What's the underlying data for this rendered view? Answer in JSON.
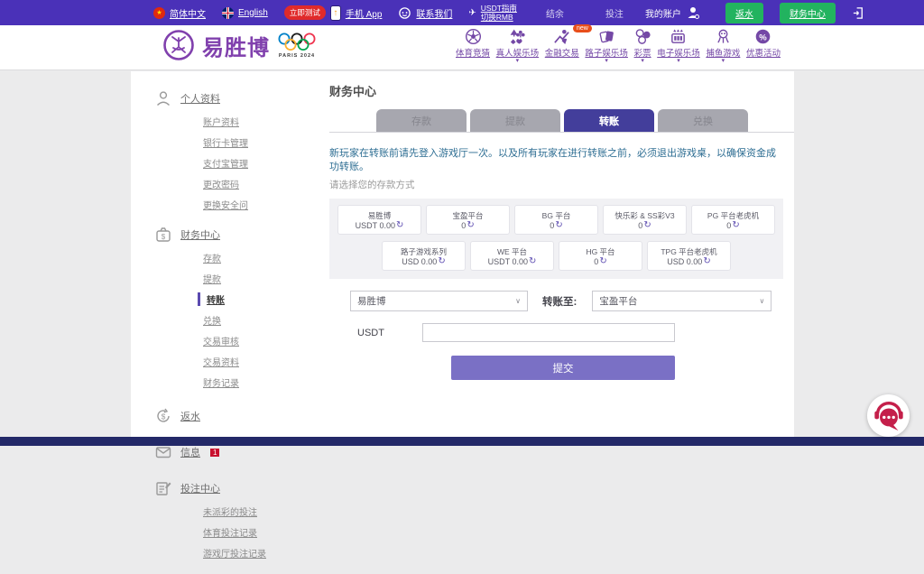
{
  "colors": {
    "topbar_purple": "#4A31B8",
    "brand_purple": "#8040AD",
    "nav_purple": "#7448A6",
    "green_button": "#22B35F",
    "active_tab_indigo": "#433E9B",
    "submit_purple": "#7A70C5",
    "notice_blue": "#2E6E93",
    "badge_red": "#E02A2A",
    "bottom_bar_navy": "#232968",
    "chat_red": "#C41F4A"
  },
  "topbar": {
    "lang_zh": "简体中文",
    "lang_en": "English",
    "test_badge": "立即测试",
    "mobile_app": "手机 App",
    "contact": "联系我们",
    "usdt_guide": "USDT指南",
    "switch_rmb": "切换RMB",
    "balance_label": "结余",
    "bet_label": "投注",
    "account_label": "我的账户",
    "rebate_button": "返水",
    "finance_button": "财务中心"
  },
  "brand": {
    "name": "易胜博",
    "olympics": "PARIS 2024"
  },
  "nav": {
    "items": [
      {
        "label": "体育竞猜"
      },
      {
        "label": "真人娱乐场"
      },
      {
        "label": "金融交易",
        "badge": "new"
      },
      {
        "label": "路子娱乐场"
      },
      {
        "label": "彩票"
      },
      {
        "label": "电子娱乐场"
      },
      {
        "label": "捕鱼游戏"
      },
      {
        "label": "优惠活动"
      }
    ]
  },
  "sidebar": {
    "profile": {
      "title": "个人资料",
      "items": [
        "账户资料",
        "银行卡管理",
        "支付宝管理",
        "更改密码",
        "更换安全问"
      ]
    },
    "finance": {
      "title": "财务中心",
      "items": [
        "存款",
        "提款",
        "转账",
        "兑换",
        "交易审核",
        "交易资料",
        "财务记录"
      ]
    },
    "rebate_title": "返水",
    "messages_title": "信息",
    "messages_badge": "1",
    "betcenter": {
      "title": "投注中心",
      "items": [
        "未派彩的投注",
        "体育投注记录",
        "游戏厅投注记录"
      ]
    }
  },
  "main": {
    "title": "财务中心",
    "tabs": [
      "存款",
      "提款",
      "转账",
      "兑换"
    ],
    "notice": "新玩家在转账前请先登入游戏厅一次。以及所有玩家在进行转账之前，必须退出游戏桌，以确保资金成功转账。",
    "hint": "请选择您的存款方式",
    "wallets_row1": [
      {
        "name": "易胜博",
        "balance": "USDT 0.00"
      },
      {
        "name": "宝盈平台",
        "balance": "0"
      },
      {
        "name": "BG 平台",
        "balance": "0"
      },
      {
        "name": "快乐彩 & SS彩V3",
        "balance": "0"
      },
      {
        "name": "PG 平台老虎机",
        "balance": "0"
      }
    ],
    "wallets_row2": [
      {
        "name": "路子游戏系列",
        "balance": "USD 0.00"
      },
      {
        "name": "WE 平台",
        "balance": "USDT 0.00"
      },
      {
        "name": "HG 平台",
        "balance": "0"
      },
      {
        "name": "TPG 平台老虎机",
        "balance": "USD 0.00"
      }
    ],
    "form": {
      "from_value": "易胜博",
      "transfer_to_label": "转账至:",
      "to_value": "宝盈平台",
      "amount_label": "USDT",
      "amount_value": "",
      "submit_label": "提交"
    }
  }
}
